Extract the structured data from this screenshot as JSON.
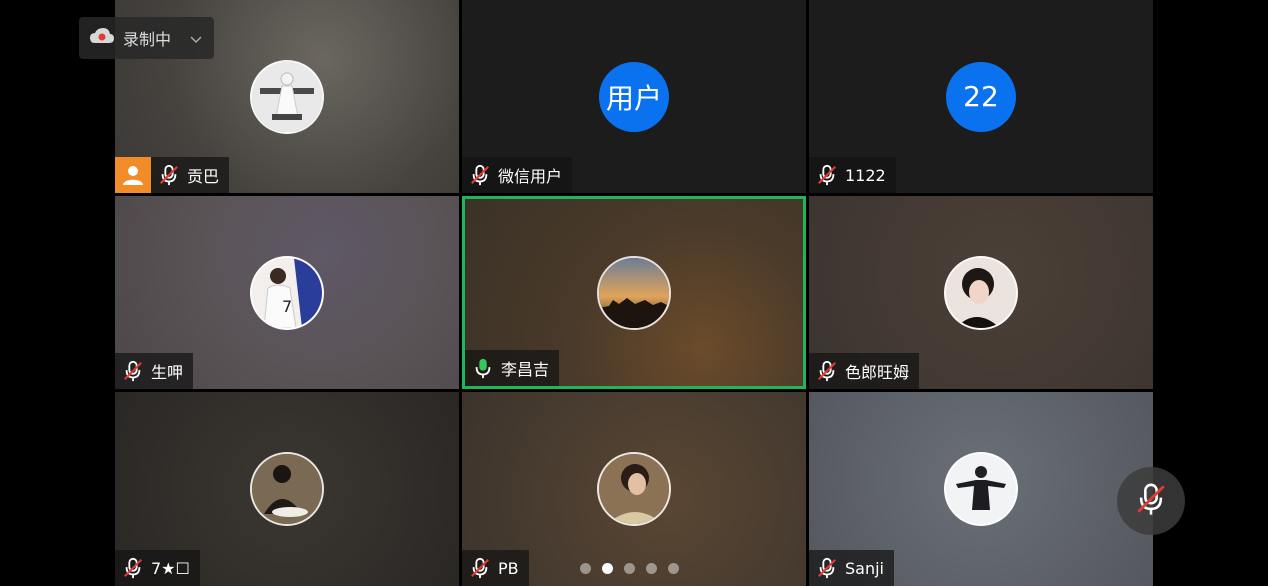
{
  "recording": {
    "label": "录制中"
  },
  "participants": [
    {
      "name": "贡巴",
      "muted": true,
      "host": true,
      "avatar_type": "photo"
    },
    {
      "name": "微信用户",
      "muted": true,
      "host": false,
      "avatar_type": "text",
      "avatar_text": "用户"
    },
    {
      "name": "1122",
      "muted": true,
      "host": false,
      "avatar_type": "text",
      "avatar_text": "22"
    },
    {
      "name": "生呷",
      "muted": true,
      "host": false,
      "avatar_type": "photo"
    },
    {
      "name": "李昌吉",
      "muted": false,
      "speaking": true,
      "host": false,
      "avatar_type": "photo"
    },
    {
      "name": "色郎旺姆",
      "muted": true,
      "host": false,
      "avatar_type": "photo"
    },
    {
      "name": "7★☐",
      "muted": true,
      "host": false,
      "avatar_type": "photo"
    },
    {
      "name": "PB",
      "muted": true,
      "host": false,
      "avatar_type": "photo"
    },
    {
      "name": "Sanji",
      "muted": true,
      "host": false,
      "avatar_type": "photo"
    }
  ],
  "pagination": {
    "total": 5,
    "current_index": 1
  },
  "colors": {
    "speaking_border": "#1fb65a",
    "avatar_blue": "#0a72ef",
    "host_badge": "#f28c28"
  },
  "icons": {
    "recording": "cloud-record-icon",
    "muted": "mic-off-icon",
    "active_mic": "mic-on-icon",
    "host": "person-icon"
  }
}
